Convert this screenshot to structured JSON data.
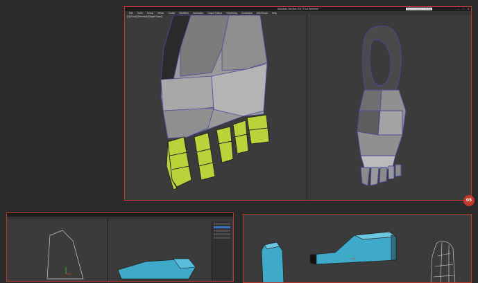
{
  "main_window": {
    "title": "Autodesk 3ds Max 2017  Foot  Welcome",
    "search_placeholder": "Type a keyword or phrase",
    "window_controls": [
      "–",
      "□",
      "✕"
    ],
    "menu": [
      "Edit",
      "Tools",
      "Group",
      "Views",
      "Create",
      "Modifiers",
      "Animation",
      "Graph Editors",
      "Rendering",
      "Customize",
      "MAXScript",
      "Help"
    ],
    "viewport_label": "[+] [Front] [Standard] [Edged Faces]"
  },
  "badge": "05",
  "colors": {
    "frame_border": "#c0392b",
    "selected_faces": "#b9d43a",
    "mesh_gray": "#9a9a9a",
    "mesh_cyan": "#3fa9c9"
  }
}
